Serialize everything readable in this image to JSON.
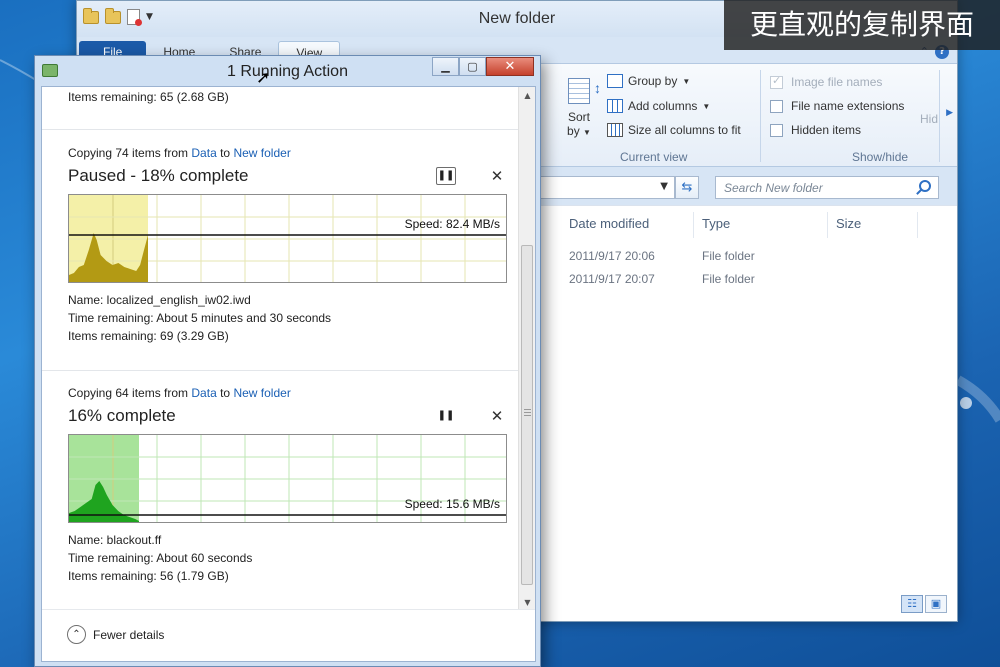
{
  "explorer": {
    "title": "New folder",
    "tabs": [
      "File",
      "Home",
      "Share",
      "View"
    ],
    "ribbon": {
      "sort_label_1": "Sort",
      "sort_label_2": "by",
      "group_by": "Group by",
      "add_columns": "Add columns",
      "size_all_columns": "Size all columns to fit",
      "current_view_label": "Current view",
      "image_file_names": "Image file names",
      "file_name_extensions": "File name extensions",
      "hidden_items": "Hidden items",
      "show_hide_label": "Show/hide",
      "hide_truncated": "Hid"
    },
    "search_placeholder": "Search New folder",
    "columns": [
      "Date modified",
      "Type",
      "Size"
    ],
    "rows": [
      {
        "date": "2011/9/17 20:06",
        "type": "File folder"
      },
      {
        "date": "2011/9/17 20:07",
        "type": "File folder"
      }
    ]
  },
  "caption": "更直观的复制界面",
  "dialog": {
    "title": "1 Running Action",
    "top_partial": "Items remaining: 65 (2.68 GB)",
    "ops": [
      {
        "copy_prefix": "Copying 74 items from",
        "source": "Data",
        "to_word": "to",
        "dest": "New folder",
        "status": "Paused - 18% complete",
        "progress": 0.18,
        "speed": "Speed: 82.4 MB/s",
        "name": "Name:  localized_english_iw02.iwd",
        "time": "Time remaining:  About 5 minutes and 30 seconds",
        "items": "Items remaining: 69 (3.29 GB)",
        "state": "paused"
      },
      {
        "copy_prefix": "Copying 64 items from",
        "source": "Data",
        "to_word": "to",
        "dest": "New folder",
        "status": "16% complete",
        "progress": 0.16,
        "speed": "Speed: 15.6 MB/s",
        "name": "Name:  blackout.ff",
        "time": "Time remaining:  About 60 seconds",
        "items": "Items remaining: 56 (1.79 GB)",
        "state": "running"
      }
    ],
    "fewer_details": "Fewer details"
  },
  "colors": {
    "paused_fill": "#f4f0a8",
    "paused_area": "#b39a14",
    "running_fill": "#a8e39a",
    "running_area": "#1fa41f",
    "link": "#1a5fb4"
  }
}
